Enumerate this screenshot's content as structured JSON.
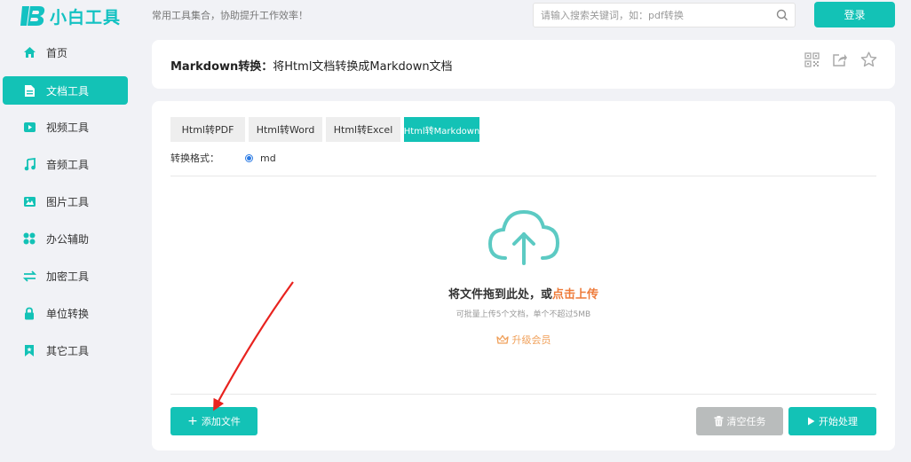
{
  "header": {
    "logo_text": "小白工具",
    "slogan": "常用工具集合，协助提升工作效率！",
    "search_placeholder": "请输入搜索关键词，如：pdf转换",
    "login_label": "登录"
  },
  "sidebar": {
    "items": [
      {
        "label": "首页",
        "icon": "home-icon"
      },
      {
        "label": "文档工具",
        "icon": "document-icon",
        "active": true
      },
      {
        "label": "视频工具",
        "icon": "video-icon"
      },
      {
        "label": "音频工具",
        "icon": "music-icon"
      },
      {
        "label": "图片工具",
        "icon": "image-icon"
      },
      {
        "label": "办公辅助",
        "icon": "grid-icon"
      },
      {
        "label": "加密工具",
        "icon": "swap-icon"
      },
      {
        "label": "单位转换",
        "icon": "lock-icon"
      },
      {
        "label": "其它工具",
        "icon": "bookmark-icon"
      }
    ]
  },
  "title_bar": {
    "title_bold": "Markdown转换：",
    "title_rest": "将Html文档转换成Markdown文档",
    "icons": [
      "qrcode-icon",
      "share-icon",
      "star-icon"
    ]
  },
  "tabs": [
    {
      "label": "Html转PDF",
      "active": false
    },
    {
      "label": "Html转Word",
      "active": false
    },
    {
      "label": "Html转Excel",
      "active": false
    },
    {
      "label": "Html转Markdown",
      "active": true
    }
  ],
  "format": {
    "label": "转换格式：",
    "option": "md"
  },
  "upload": {
    "main_text": "将文件拖到此处，或",
    "main_link": "点击上传",
    "sub_text": "可批量上传5个文档，单个不超过5MB",
    "upgrade_label": "升级会员"
  },
  "actions": {
    "add_label": "添加文件",
    "clear_label": "清空任务",
    "start_label": "开始处理"
  },
  "colors": {
    "accent": "#13c2b6",
    "highlight": "#ee7b3a",
    "annotation_arrow": "#e8231f"
  }
}
